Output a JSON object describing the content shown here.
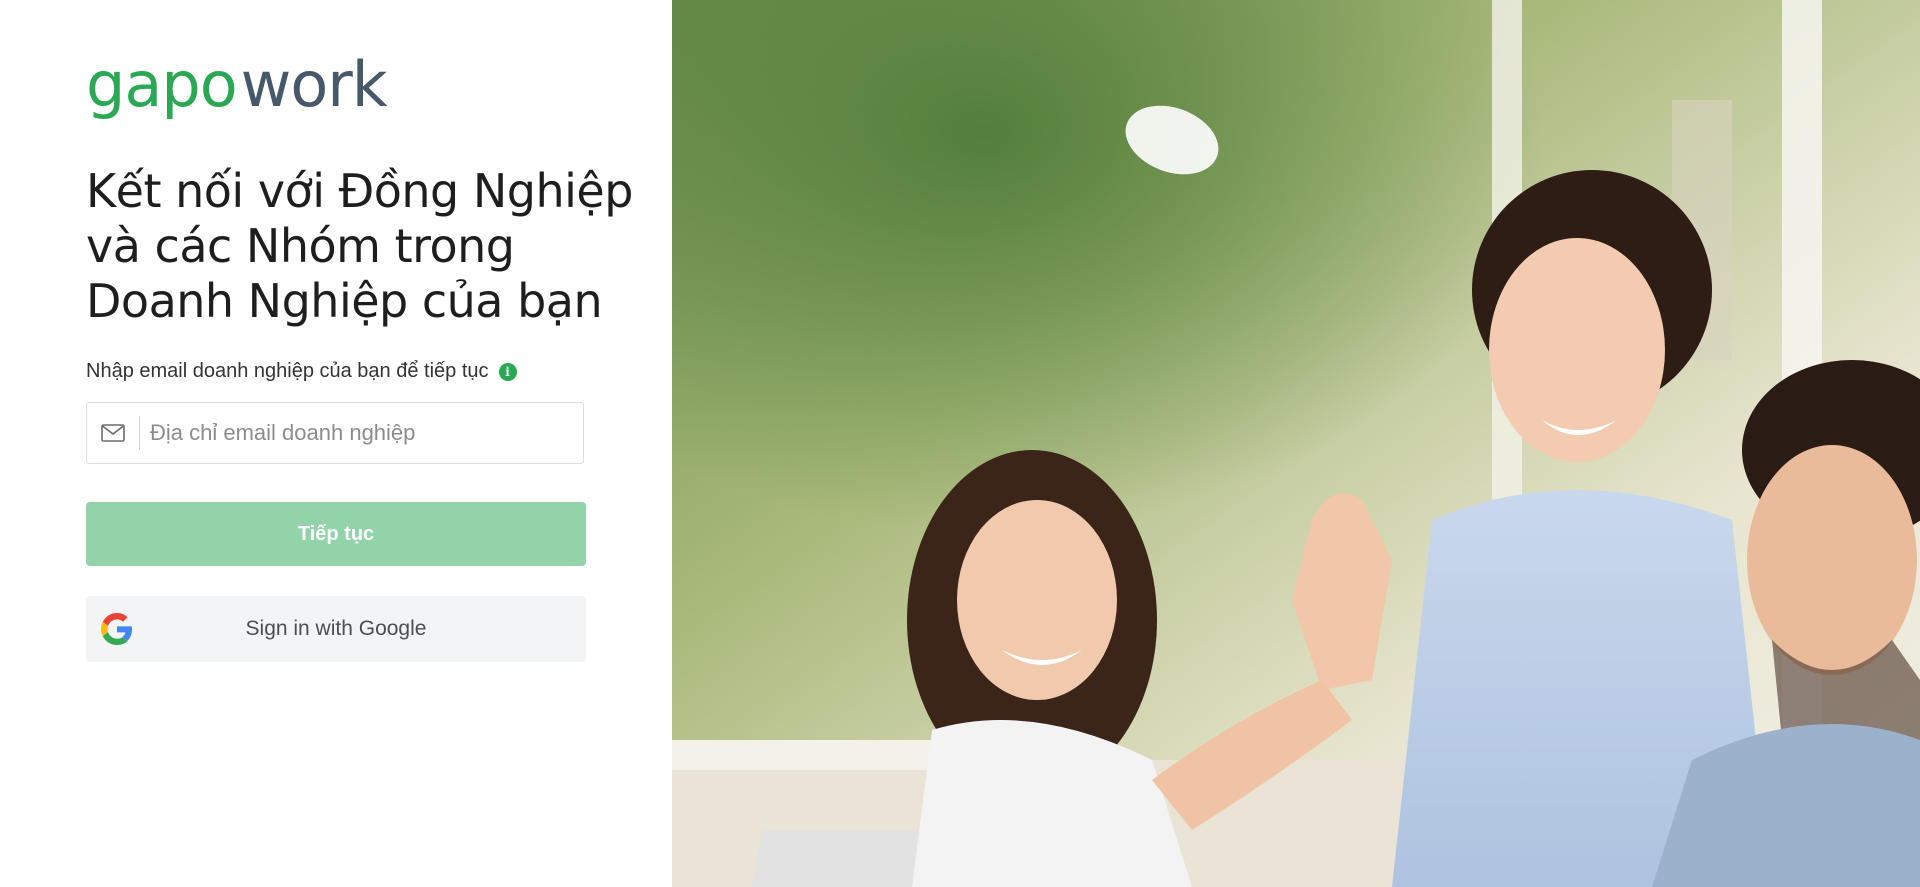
{
  "brand": {
    "logo_part1": "gapo",
    "logo_part2": "work",
    "color_primary": "#2aa853",
    "color_secondary": "#45596a"
  },
  "login": {
    "headline_line1": "Kết nối với Đồng Nghiệp",
    "headline_line2": "và các Nhóm trong",
    "headline_line3": "Doanh Nghiệp của bạn",
    "prompt": "Nhập email doanh nghiệp của bạn để tiếp tục",
    "info_icon_glyph": "i",
    "email_placeholder": "Địa chỉ email doanh nghiệp",
    "email_value": "",
    "continue_label": "Tiếp tục",
    "google_label": "Sign in with Google"
  },
  "icons": {
    "email_field": "mail-icon",
    "info": "info-icon",
    "google": "google-icon"
  },
  "colors": {
    "continue_button_bg": "#92d3aa",
    "google_button_bg": "#f3f4f6"
  },
  "hero": {
    "image": "photo-of-three-colleagues-high-five"
  }
}
